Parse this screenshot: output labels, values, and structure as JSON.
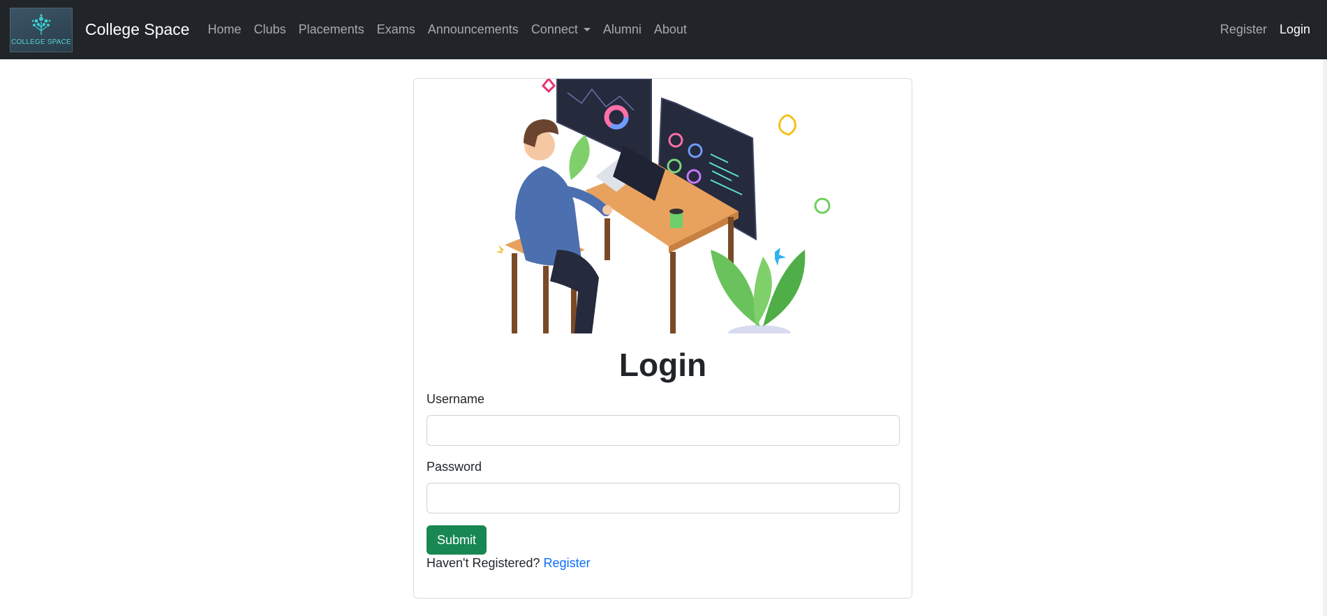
{
  "navbar": {
    "logo_text": "COLLEGE SPACE",
    "brand": "College Space",
    "links": [
      "Home",
      "Clubs",
      "Placements",
      "Exams",
      "Announcements",
      "Connect",
      "Alumni",
      "About"
    ],
    "right_links": [
      "Register",
      "Login"
    ],
    "background": "#212529"
  },
  "login": {
    "title": "Login",
    "username_label": "Username",
    "username_value": "",
    "password_label": "Password",
    "password_value": "",
    "submit_label": "Submit",
    "prompt_text": "Haven't Registered?",
    "register_link": "Register",
    "hero_image": "developer-at-desk-illustration"
  },
  "colors": {
    "submit": "#198754",
    "link": "#0d6efd"
  }
}
